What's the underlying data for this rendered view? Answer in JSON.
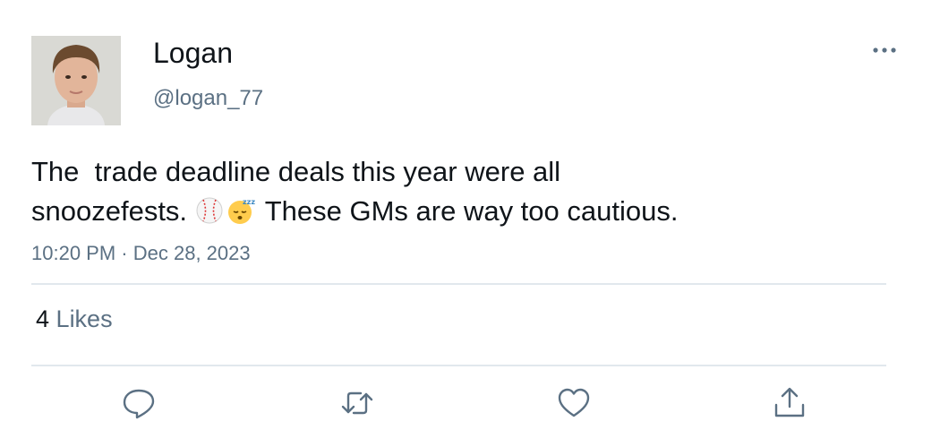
{
  "user": {
    "display_name": "Logan",
    "handle": "@logan_77"
  },
  "tweet": {
    "text_line1": "The  trade deadline deals this year were all",
    "text_line2_before": "snoozefests. ",
    "emojis": [
      "baseball-emoji",
      "sleeping-face-emoji"
    ],
    "text_line2_after": " These GMs are way too cautious.",
    "time": "10:20 PM",
    "separator": "·",
    "date": "Dec 28, 2023"
  },
  "stats": {
    "likes_count": "4",
    "likes_label": "Likes"
  },
  "actions": [
    "reply-icon",
    "retweet-icon",
    "like-icon",
    "share-icon"
  ],
  "colors": {
    "text": "#0f1419",
    "secondary": "#5b7083",
    "divider": "#e1e8ed",
    "icon": "#5b7083"
  }
}
